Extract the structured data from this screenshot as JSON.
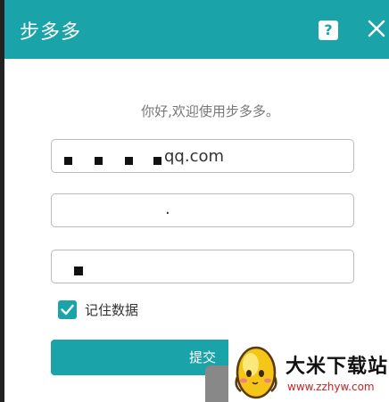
{
  "window": {
    "title": "步多多",
    "help_label": "?",
    "icons": {
      "help": "help-icon",
      "close": "close-icon"
    }
  },
  "form": {
    "greeting": "你好,欢迎使用步多多。",
    "account_value": "qq.com",
    "password_value": ".",
    "remember_label": "记住数据",
    "remember_checked": true,
    "submit_label": "提交"
  },
  "watermark": {
    "brand": "大米下载站",
    "url": "www.zzhyw.com"
  },
  "colors": {
    "accent": "#1aa3a8",
    "watermark_url": "#d02020"
  }
}
